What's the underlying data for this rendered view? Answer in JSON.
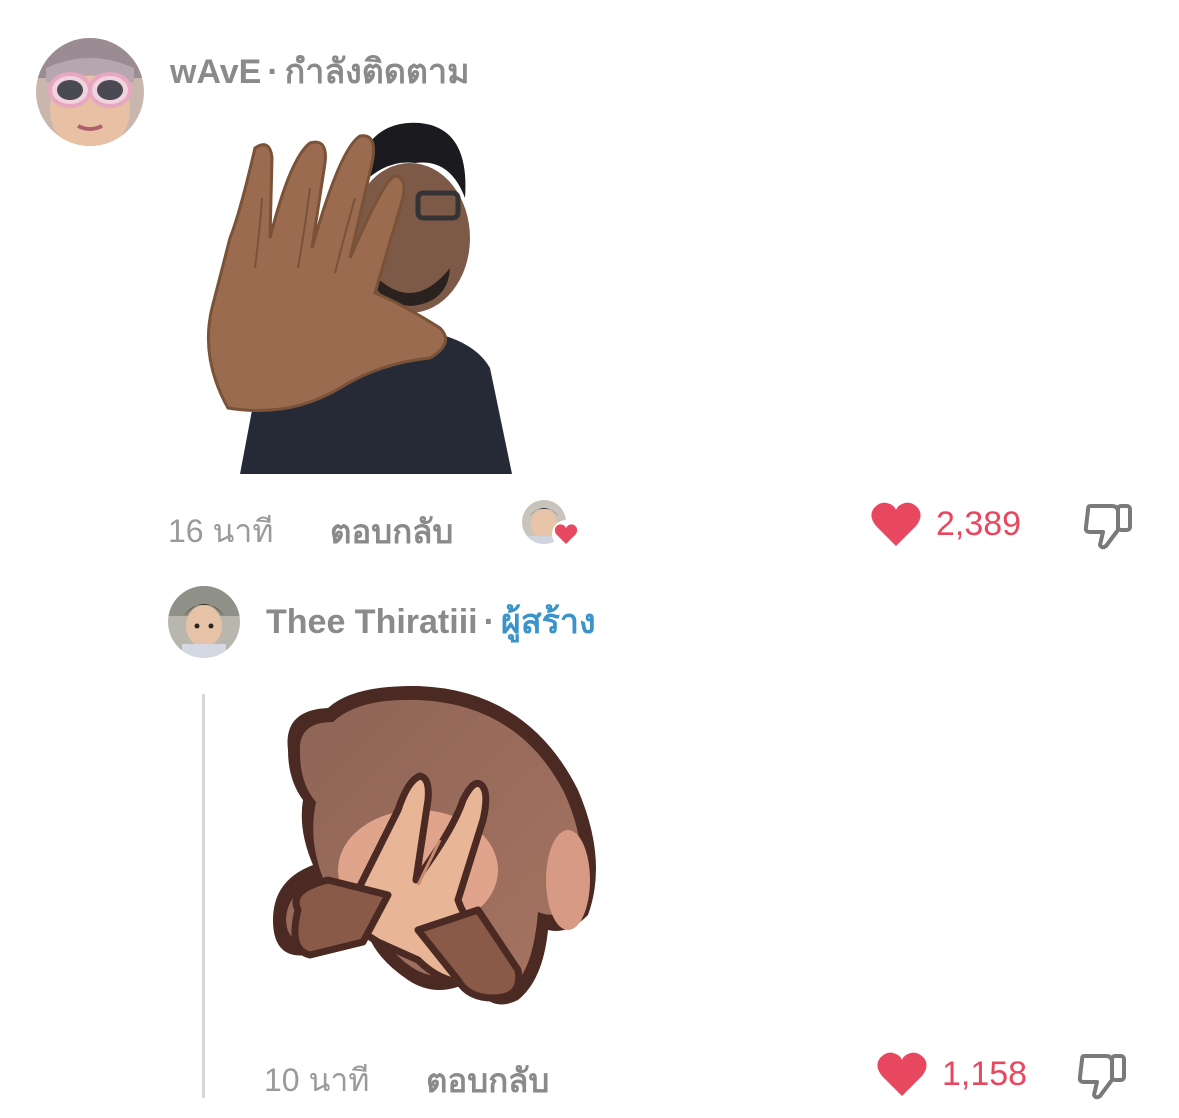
{
  "comment": {
    "username": "wAvE",
    "separator": "·",
    "follow_status": "กำลังติดตาม",
    "timestamp": "16 นาที",
    "reply_label": "ตอบกลับ",
    "like_count": "2,389",
    "sticker_icon": "person-hand-up-sticker",
    "creator_liked_icon": "creator-heart-avatar-icon"
  },
  "reply": {
    "username": "Thee Thiratiii",
    "separator": "·",
    "creator_label": "ผู้สร้าง",
    "timestamp": "10 นาที",
    "reply_label": "ตอบกลับ",
    "like_count": "1,158",
    "sticker_icon": "praying-hands-sticker"
  },
  "colors": {
    "like": "#e8485f",
    "creator": "#3a93c9",
    "muted": "#8a8a8a"
  }
}
